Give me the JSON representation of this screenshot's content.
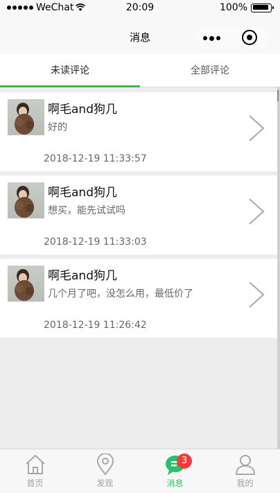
{
  "status_bar": {
    "carrier": "WeChat",
    "time": "20:09",
    "battery": "100%"
  },
  "nav": {
    "title": "消息"
  },
  "tabs": [
    {
      "label": "未读评论",
      "active": true
    },
    {
      "label": "全部评论",
      "active": false
    }
  ],
  "comments": [
    {
      "name": "啊毛and狗几",
      "text": "好的",
      "time": "2018-12-19 11:33:57"
    },
    {
      "name": "啊毛and狗几",
      "text": "想买，能先试试吗",
      "time": "2018-12-19 11:33:03"
    },
    {
      "name": "啊毛and狗几",
      "text": "几个月了吧，没怎么用，最低价了",
      "time": "2018-12-19 11:26:42"
    }
  ],
  "tab_bar": {
    "items": [
      {
        "label": "首页",
        "icon": "home-icon",
        "active": false
      },
      {
        "label": "发现",
        "icon": "location-pin-icon",
        "active": false
      },
      {
        "label": "消息",
        "icon": "message-icon",
        "active": true
      },
      {
        "label": "我的",
        "icon": "user-icon",
        "active": false
      }
    ],
    "badge": "3"
  },
  "colors": {
    "accent_green": "#3cbc3c",
    "active_tab_green": "#2bbf6a",
    "badge_red": "#f23b3b"
  }
}
